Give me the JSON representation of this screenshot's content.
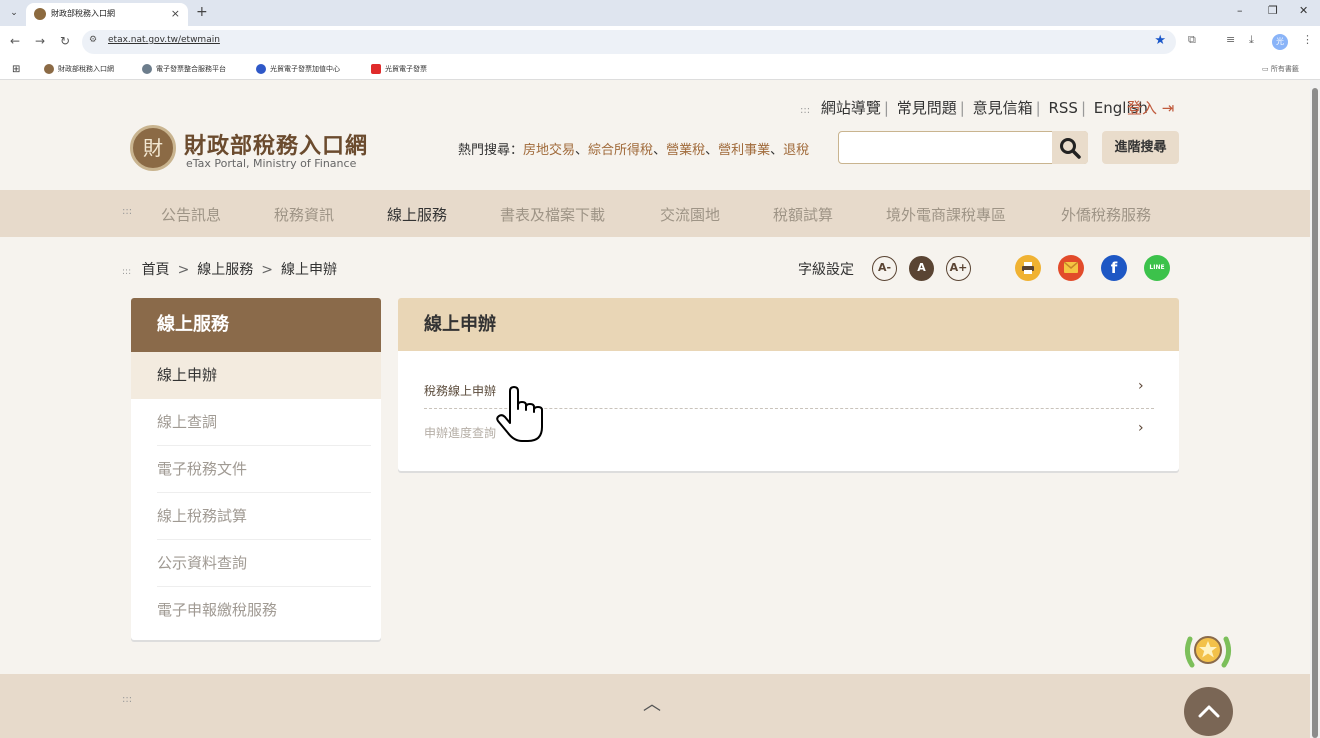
{
  "browser": {
    "tab_title": "財政部稅務入口網",
    "tab_close": "×",
    "new_tab": "+",
    "url": "etax.nat.gov.tw/etwmain",
    "bookmarks": [
      "財政部稅務入口網",
      "電子發票整合服務平台",
      "光貿電子發票加值中心",
      "光貿電子發票"
    ],
    "bookmarks_folder": "所有書籤",
    "profile_initial": "光"
  },
  "header": {
    "top_links": [
      "網站導覽",
      "常見問題",
      "意見信箱",
      "RSS",
      "English"
    ],
    "top_links_dots": ":::",
    "login": "登入",
    "logo_title": "財政部稅務入口網",
    "logo_subtitle": "eTax Portal, Ministry of Finance",
    "logo_glyph": "財",
    "hot_search_label": "熱門搜尋：",
    "hot_keywords": [
      "房地交易",
      "綜合所得稅",
      "營業稅",
      "營利事業",
      "退稅"
    ],
    "keyword_sep": "、",
    "search_placeholder": "",
    "advanced_search": "進階搜尋"
  },
  "nav": {
    "dots": ":::",
    "items": [
      "公告訊息",
      "稅務資訊",
      "線上服務",
      "書表及檔案下載",
      "交流園地",
      "稅額試算",
      "境外電商課稅專區",
      "外僑稅務服務"
    ],
    "active": "線上服務"
  },
  "breadcrumb": {
    "dots": ":::",
    "items": [
      "首頁",
      "線上服務",
      "線上申辦"
    ],
    "separator": ">"
  },
  "font_settings": {
    "label": "字級設定",
    "buttons": [
      "A-",
      "A",
      "A+"
    ],
    "current": "A"
  },
  "share": {
    "facebook": "f",
    "line": "LINE"
  },
  "sidebar": {
    "title": "線上服務",
    "items": [
      "線上申辦",
      "線上查調",
      "電子稅務文件",
      "線上稅務試算",
      "公示資料查詢",
      "電子申報繳稅服務"
    ],
    "active": "線上申辦"
  },
  "content": {
    "title": "線上申辦",
    "links": [
      "稅務線上申辦",
      "申辦進度查詢"
    ]
  },
  "footer": {
    "dots": ":::"
  },
  "colors": {
    "brand_brown": "#8a6a4a",
    "nav_bg": "#e7dacb",
    "panel_header": "#e9d6b6",
    "login_red": "#c05a3c"
  }
}
